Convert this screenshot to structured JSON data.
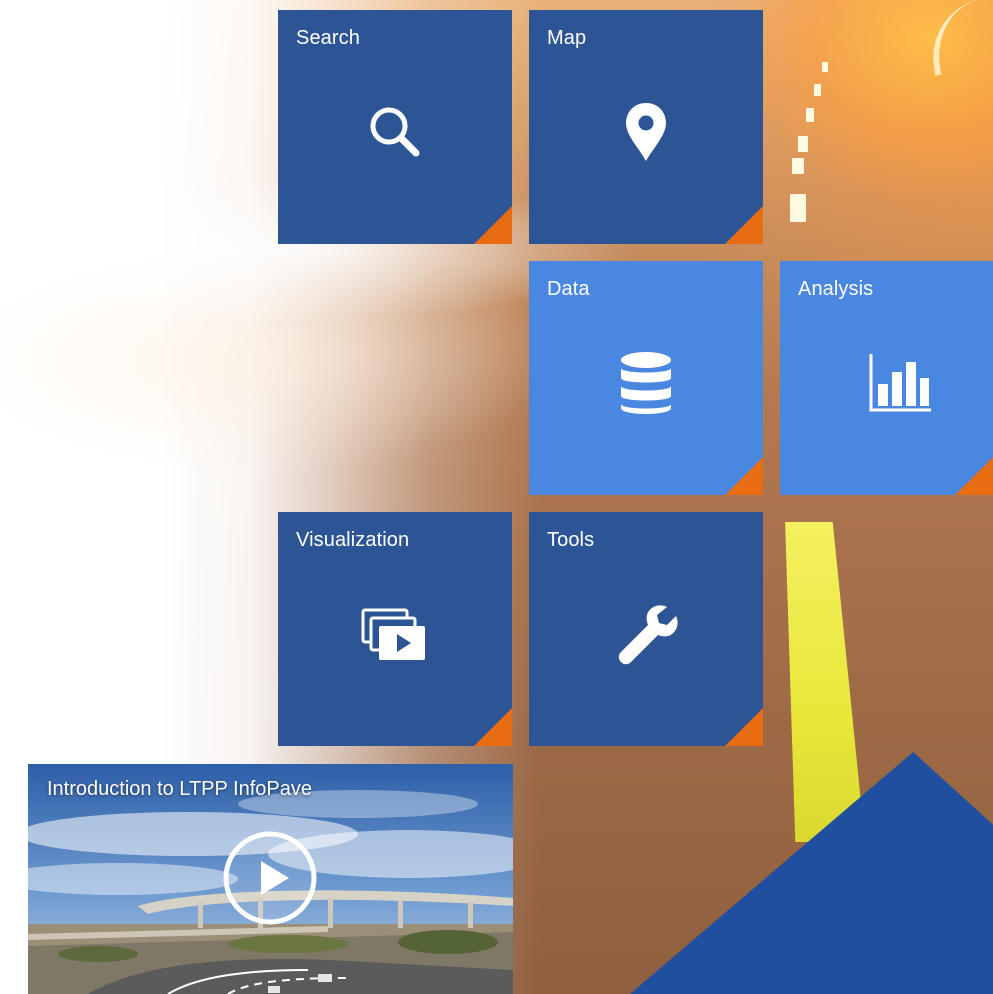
{
  "tiles": [
    {
      "id": "search",
      "label": "Search",
      "icon": "search-icon"
    },
    {
      "id": "map",
      "label": "Map",
      "icon": "map-pin-icon"
    },
    {
      "id": "data",
      "label": "Data",
      "icon": "database-icon"
    },
    {
      "id": "analysis",
      "label": "Analysis",
      "icon": "bar-chart-icon"
    },
    {
      "id": "visualization",
      "label": "Visualization",
      "icon": "media-gallery-icon"
    },
    {
      "id": "tools",
      "label": "Tools",
      "icon": "wrench-icon"
    }
  ],
  "video": {
    "title": "Introduction to LTPP InfoPave",
    "icon": "play-button-icon"
  },
  "colors": {
    "tile_dark": "#2d5596",
    "tile_light": "#4a87e0",
    "corner_accent": "#e86c12",
    "triangle": "#1f4f9e",
    "road_line": "#e8e83a"
  }
}
